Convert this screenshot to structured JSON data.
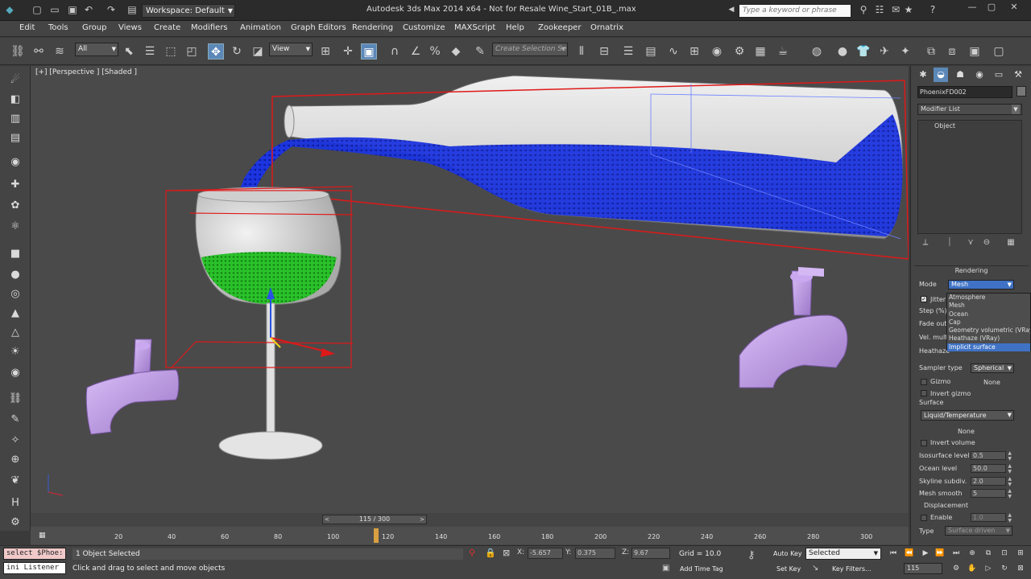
{
  "title_bar": {
    "workspace": "Workspace: Default",
    "app_title": "Autodesk 3ds Max  2014 x64  -  Not for Resale     Wine_Start_01B_.max",
    "search_placeholder": "Type a keyword or phrase"
  },
  "menu": [
    "Edit",
    "Tools",
    "Group",
    "Views",
    "Create",
    "Modifiers",
    "Animation",
    "Graph Editors",
    "Rendering",
    "Customize",
    "MAXScript",
    "Help",
    "Zookeeper",
    "Ornatrix"
  ],
  "toolbar": {
    "selection_filter": "All",
    "ref_coord": "View",
    "named_selection_placeholder": "Create Selection Se"
  },
  "viewport": {
    "label": "[+] [Perspective ] [Shaded ]"
  },
  "command_panel": {
    "object_name": "PhoenixFD002",
    "modifier_list": "Modifier List",
    "stack_item": "Object",
    "rollout_title": "Rendering",
    "mode_label": "Mode",
    "mode_value": "Mesh",
    "mode_options": [
      "Atmosphere",
      "Mesh",
      "Ocean",
      "Cap",
      "Geometry volumetric (VRay)",
      "Heathaze (VRay)",
      "Implicit surface"
    ],
    "mode_selected_option": "Implicit surface",
    "jitter_label": "Jitter",
    "step_label": "Step (%)",
    "fade_label": "Fade out",
    "vel_label": "Vel. multi",
    "heathaze_label": "Heathaze",
    "sampler_label": "Sampler type",
    "sampler_value": "Spherical",
    "gizmo_label": "Gizmo",
    "gizmo_value": "None",
    "invert_gizmo_label": "Invert gizmo",
    "surface_label": "Surface",
    "surface_value": "Liquid/Temperature",
    "surface_none": "None",
    "invert_volume_label": "Invert volume",
    "isosurface_label": "Isosurface level",
    "isosurface_value": "0.5",
    "ocean_label": "Ocean level",
    "ocean_value": "50.0",
    "skyline_label": "Skyline subdiv.",
    "skyline_value": "2.0",
    "meshsmooth_label": "Mesh smooth",
    "meshsmooth_value": "5",
    "displacement_label": "Displacement",
    "enable_label": "Enable",
    "enable_value": "1.0",
    "type_label": "Type",
    "type_value": "Surface driven"
  },
  "timeline": {
    "slider_label": "115 / 300",
    "current_frame": 115,
    "total_frames": 300,
    "ruler_labels": [
      "20",
      "40",
      "60",
      "80",
      "100",
      "120",
      "140",
      "160",
      "180",
      "200",
      "220",
      "240",
      "260",
      "280",
      "300"
    ]
  },
  "status": {
    "maxscript_line1": "select $Phoe:",
    "maxscript_line2": "ini Listener",
    "selected_count": "1 Object Selected",
    "prompt": "Click and drag to select and move objects",
    "x_label": "X:",
    "x_value": "-5.657",
    "y_label": "Y:",
    "y_value": "0.375",
    "z_label": "Z:",
    "z_value": "9.67",
    "grid": "Grid = 10.0",
    "add_time_tag": "Add Time Tag",
    "auto_key": "Auto Key",
    "set_key": "Set Key",
    "selected_combo": "Selected",
    "key_filters": "Key Filters...",
    "frame_value": "115"
  },
  "colors": {
    "accent": "#5c88b8",
    "liquid_blue": "#1a2fd6",
    "liquid_green": "#2dbd2d",
    "faucet": "#c6a2ec",
    "selection_red": "#e01818"
  }
}
